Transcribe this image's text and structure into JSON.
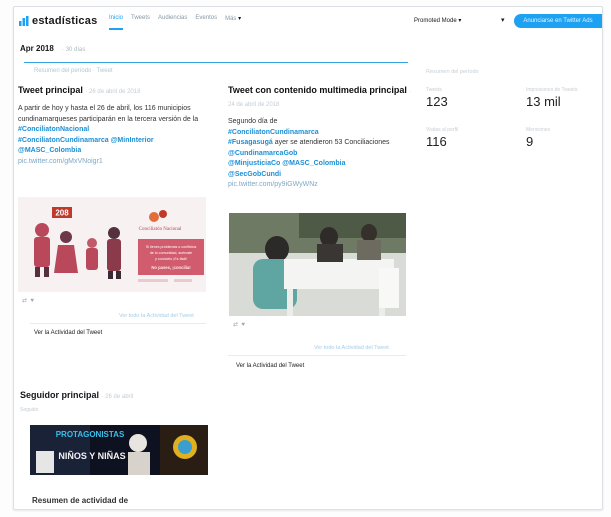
{
  "nav": {
    "brand": "estadísticas",
    "tabs": [
      "Inicio",
      "Tweets",
      "Audiencias",
      "Eventos",
      "Más"
    ],
    "account_menu": "Promoted Mode",
    "ads_button": "Anunciarse en Twitter Ads"
  },
  "header": {
    "period": "Apr 2018",
    "period_sub": "· 30 días",
    "summary_label": "Resumen del período · Tweet"
  },
  "top_tweet": {
    "title": "Tweet principal",
    "date": "· 26 de abril de 2018",
    "text_intro": "A partir de hoy y hasta el 26 de abril, los 116 municipios cundinamarqueses participarán en la tercera versión de la",
    "tags": [
      "#ConciliatonNacional",
      "#ConciliatonCundinamarca",
      "@MinInterior",
      "@MASC_Colombia"
    ],
    "link": "pic.twitter.com/gMxVNoigr1",
    "image": {
      "badge": "208",
      "logo": "Conciliatón Nacional",
      "banner_line1": "Si tienes problemas o conflictos",
      "banner_line2": "de tu comunidad, acércate",
      "banner_line3": "y conócelo ¡Es fácil!",
      "cta": "No pases, ¡concilia!"
    },
    "view_activity": "Ver todo la Actividad del Tweet",
    "activity_label": "Ver la Actividad del Tweet"
  },
  "media_tweet": {
    "title": "Tweet con contenido multimedia principal",
    "date": "· 24 de abril de 2018",
    "text_intro": "Segundo día de",
    "tags": [
      "#ConciliatonCundinamarca",
      "#Fusagasugá",
      "@CundinamarcaGob",
      "@MinjusticiaCo",
      "@MASC_Colombia",
      "@SecGobCundi"
    ],
    "text_mid": "ayer se atendieron 53 Conciliaciones",
    "link": "pic.twitter.com/py9iGWyWNz",
    "view_activity": "Ver todo la Actividad del Tweet",
    "activity_label": "Ver la Actividad del Tweet"
  },
  "stats": {
    "head": "Resumen del período",
    "items": [
      {
        "label": "Tweets",
        "value": "123"
      },
      {
        "label": "Impresiones de Tweets",
        "value": "13 mil"
      },
      {
        "label": "Visitas al perfil",
        "value": "116"
      },
      {
        "label": "Menciones",
        "value": "9"
      }
    ]
  },
  "top_follower": {
    "title": "Seguidor principal",
    "date": "· 26 de abril",
    "sub": "Seguido",
    "banner_text1": "PROTAGONISTAS",
    "banner_text2": "NIÑOS Y NIÑAS"
  },
  "bottom_heading": "Resumen de actividad de",
  "colors": {
    "accent": "#1da1f2",
    "tag": "#1b8fd6"
  }
}
